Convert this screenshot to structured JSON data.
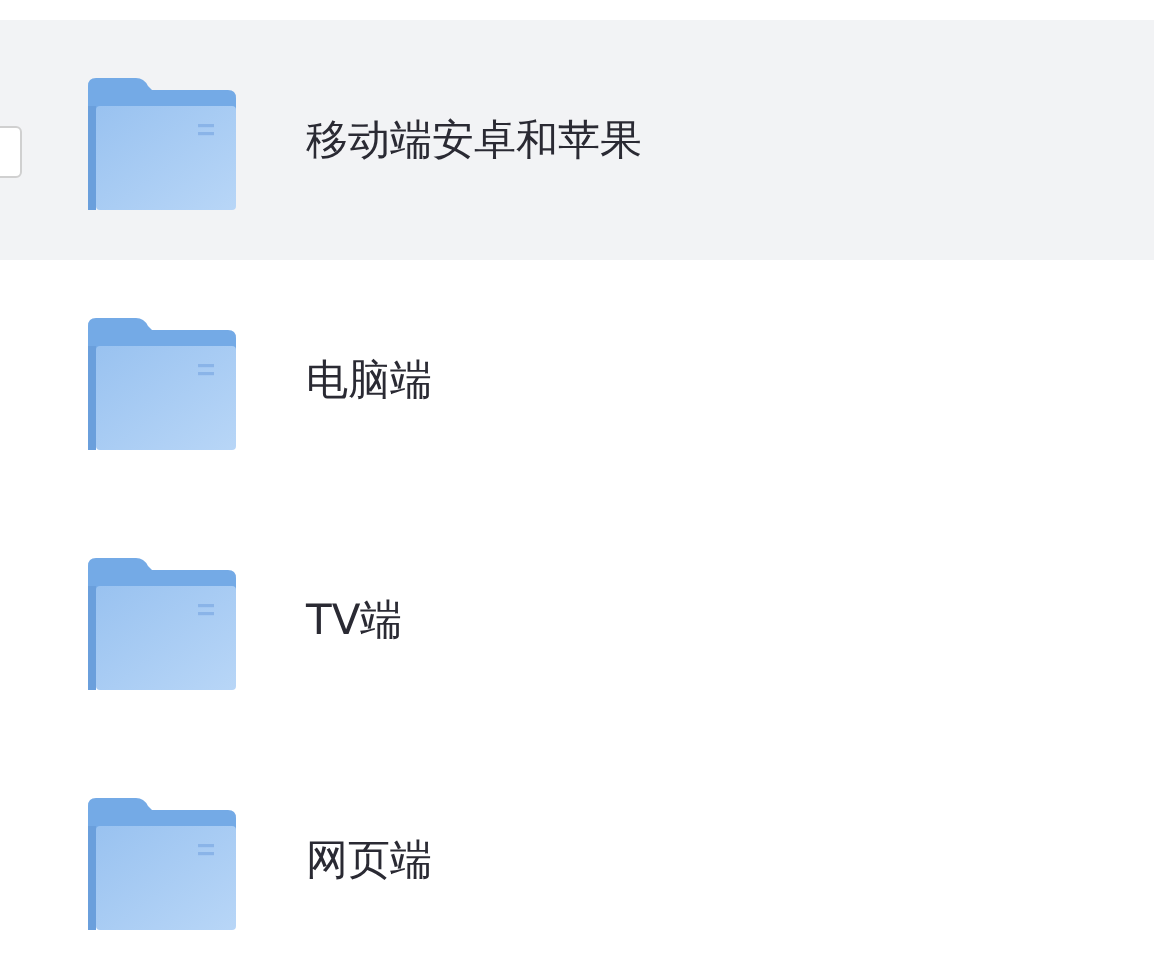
{
  "files": [
    {
      "name": "移动端安卓和苹果",
      "hovered": true
    },
    {
      "name": "电脑端",
      "hovered": false
    },
    {
      "name": "TV端",
      "hovered": false
    },
    {
      "name": "网页端",
      "hovered": false
    }
  ]
}
